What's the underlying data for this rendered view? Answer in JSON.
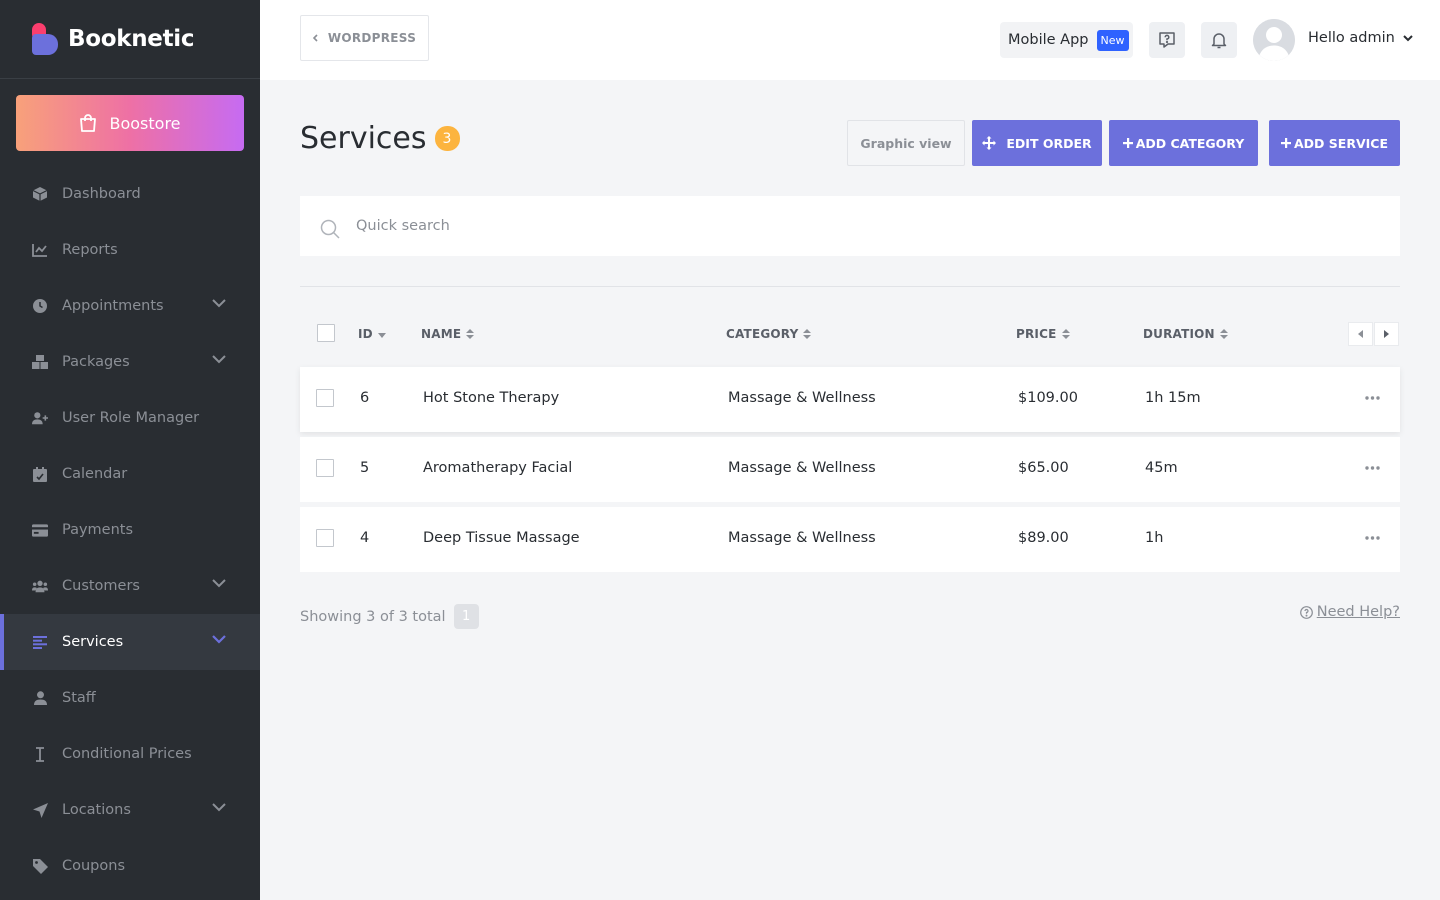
{
  "app": {
    "name": "Booknetic"
  },
  "sidebar": {
    "boostore_label": "Boostore",
    "items": [
      {
        "label": "Dashboard",
        "icon": "dashboard-icon",
        "has_children": false,
        "active": false
      },
      {
        "label": "Reports",
        "icon": "chart-line-icon",
        "has_children": false,
        "active": false
      },
      {
        "label": "Appointments",
        "icon": "clock-icon",
        "has_children": true,
        "active": false
      },
      {
        "label": "Packages",
        "icon": "boxes-icon",
        "has_children": true,
        "active": false
      },
      {
        "label": "User Role Manager",
        "icon": "user-plus-icon",
        "has_children": false,
        "active": false
      },
      {
        "label": "Calendar",
        "icon": "calendar-icon",
        "has_children": false,
        "active": false
      },
      {
        "label": "Payments",
        "icon": "credit-card-icon",
        "has_children": false,
        "active": false
      },
      {
        "label": "Customers",
        "icon": "users-icon",
        "has_children": true,
        "active": false
      },
      {
        "label": "Services",
        "icon": "align-left-icon",
        "has_children": true,
        "active": true
      },
      {
        "label": "Staff",
        "icon": "user-icon",
        "has_children": false,
        "active": false
      },
      {
        "label": "Conditional Prices",
        "icon": "i-cursor-icon",
        "has_children": false,
        "active": false
      },
      {
        "label": "Locations",
        "icon": "location-arrow-icon",
        "has_children": true,
        "active": false
      },
      {
        "label": "Coupons",
        "icon": "tag-icon",
        "has_children": false,
        "active": false
      }
    ]
  },
  "topbar": {
    "wordpress_label": "WORDPRESS",
    "mobile_app_label": "Mobile App",
    "mobile_app_badge": "New",
    "greeting": "Hello admin"
  },
  "page": {
    "title": "Services",
    "count": "3",
    "buttons": {
      "graphic_view": "Graphic view",
      "edit_order": "EDIT ORDER",
      "add_category": "ADD CATEGORY",
      "add_service": "ADD SERVICE"
    },
    "search_placeholder": "Quick search"
  },
  "table": {
    "columns": [
      "ID",
      "NAME",
      "CATEGORY",
      "PRICE",
      "DURATION"
    ],
    "rows": [
      {
        "id": "6",
        "name": "Hot Stone Therapy",
        "category": "Massage & Wellness",
        "price": "$109.00",
        "duration": "1h 15m"
      },
      {
        "id": "5",
        "name": "Aromatherapy Facial",
        "category": "Massage & Wellness",
        "price": "$65.00",
        "duration": "45m"
      },
      {
        "id": "4",
        "name": "Deep Tissue Massage",
        "category": "Massage & Wellness",
        "price": "$89.00",
        "duration": "1h"
      }
    ]
  },
  "footer": {
    "showing": "Showing 3 of 3 total",
    "page": "1",
    "help": "Need Help?"
  },
  "colors": {
    "sidebar_bg": "#292d32",
    "accent": "#6c70dc",
    "count_badge": "#fcb43f",
    "new_badge": "#2f62ff"
  }
}
